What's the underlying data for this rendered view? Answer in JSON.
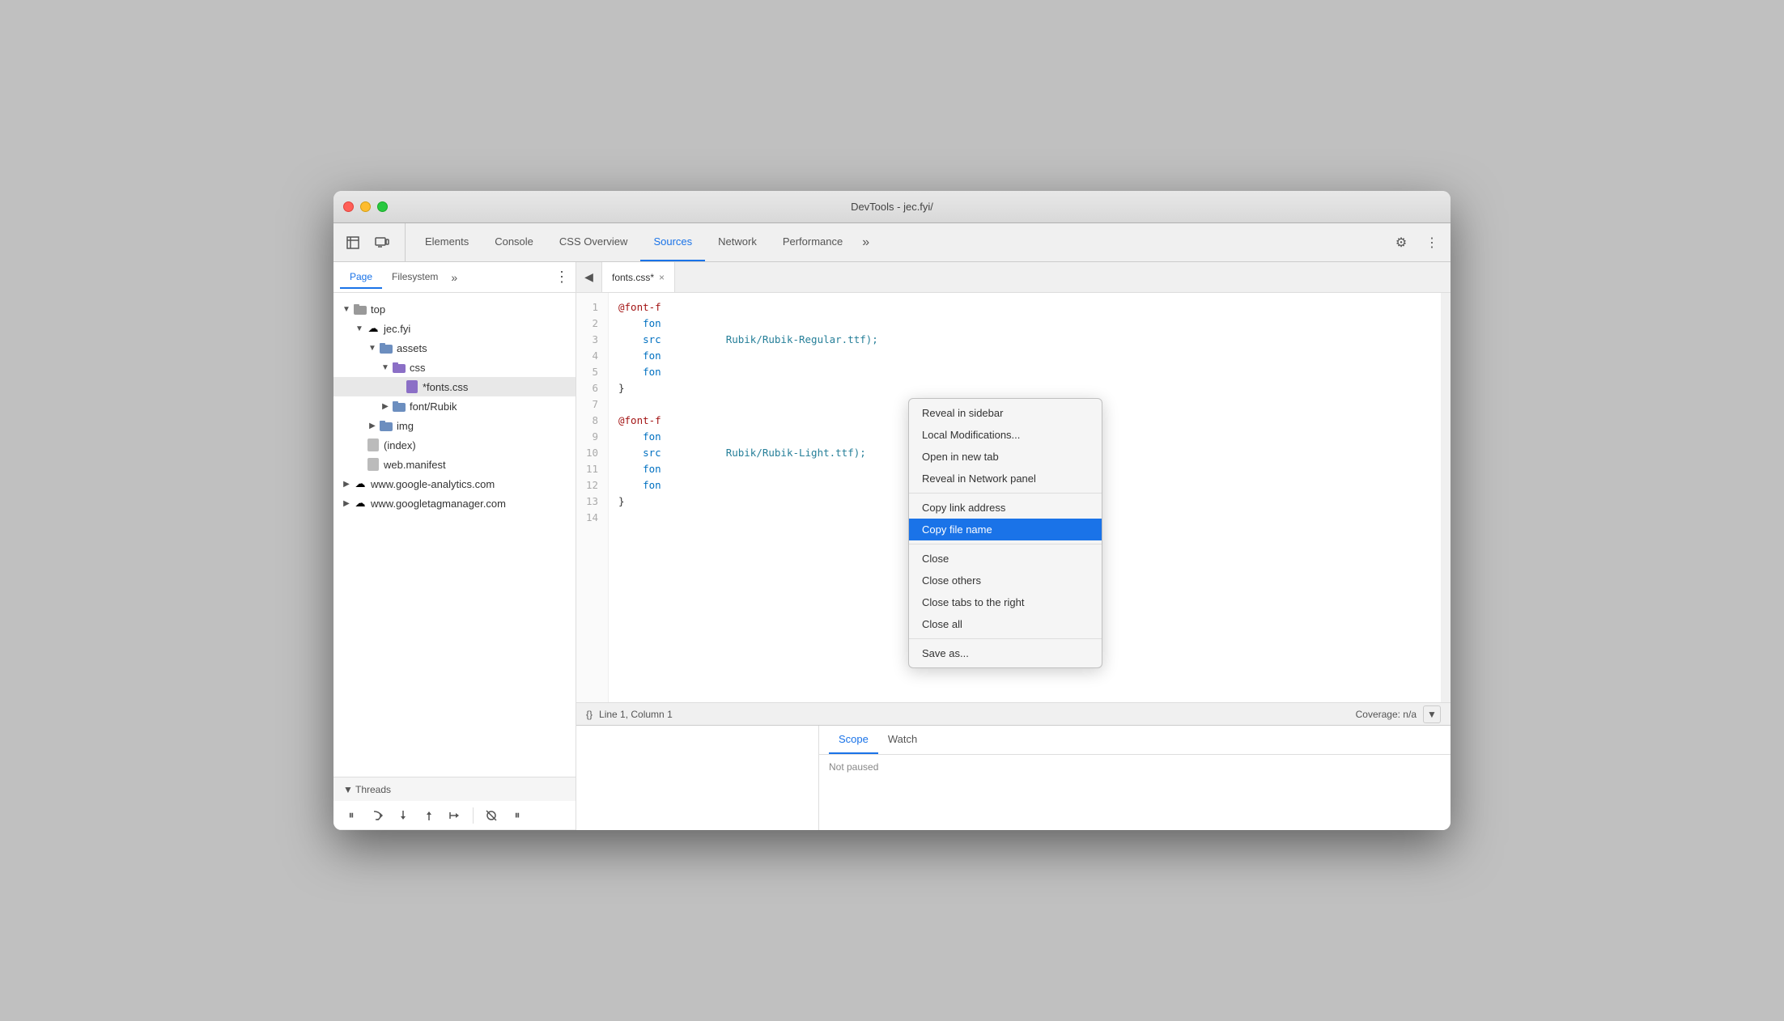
{
  "window": {
    "title": "DevTools - jec.fyi/"
  },
  "tabbar": {
    "inspect_icon": "⬚",
    "device_icon": "▭",
    "tabs": [
      {
        "label": "Elements",
        "active": false
      },
      {
        "label": "Console",
        "active": false
      },
      {
        "label": "CSS Overview",
        "active": false
      },
      {
        "label": "Sources",
        "active": true
      },
      {
        "label": "Network",
        "active": false
      },
      {
        "label": "Performance",
        "active": false
      }
    ],
    "more_label": "»",
    "gear_icon": "⚙",
    "dots_icon": "⋮"
  },
  "sidebar": {
    "tabs": [
      {
        "label": "Page",
        "active": true
      },
      {
        "label": "Filesystem",
        "active": false
      }
    ],
    "more_label": "»",
    "options_icon": "⋮",
    "tree": [
      {
        "label": "top",
        "level": 1,
        "type": "folder-plain",
        "expanded": true,
        "toggle": "▼"
      },
      {
        "label": "jec.fyi",
        "level": 2,
        "type": "cloud",
        "expanded": true,
        "toggle": "▼"
      },
      {
        "label": "assets",
        "level": 3,
        "type": "folder",
        "expanded": true,
        "toggle": "▼"
      },
      {
        "label": "css",
        "level": 4,
        "type": "folder-purple",
        "expanded": true,
        "toggle": "▼"
      },
      {
        "label": "*fonts.css",
        "level": 5,
        "type": "file-css",
        "selected": true
      },
      {
        "label": "font/Rubik",
        "level": 4,
        "type": "folder",
        "expanded": false,
        "toggle": "▶"
      },
      {
        "label": "img",
        "level": 3,
        "type": "folder",
        "expanded": false,
        "toggle": "▶"
      },
      {
        "label": "(index)",
        "level": 2,
        "type": "file-gray"
      },
      {
        "label": "web.manifest",
        "level": 2,
        "type": "file-gray"
      },
      {
        "label": "www.google-analytics.com",
        "level": 1,
        "type": "cloud",
        "expanded": false,
        "toggle": "▶"
      },
      {
        "label": "www.googletagmanager.com",
        "level": 1,
        "type": "cloud",
        "expanded": false,
        "toggle": "▶"
      }
    ]
  },
  "file_tab": {
    "name": "fonts.css*",
    "close": "×"
  },
  "code": {
    "lines": [
      {
        "num": 1,
        "content": "@font-f",
        "class": "c-red"
      },
      {
        "num": 2,
        "content": "    fon",
        "class": "c-blue"
      },
      {
        "num": 3,
        "content": "    src",
        "class": "c-blue",
        "suffix": "Rubik/Rubik-Regular.ttf);",
        "suffix_class": "c-teal"
      },
      {
        "num": 4,
        "content": "    fon",
        "class": "c-blue"
      },
      {
        "num": 5,
        "content": "    fon",
        "class": "c-blue"
      },
      {
        "num": 6,
        "content": "}",
        "class": "c-dark"
      },
      {
        "num": 7,
        "content": "",
        "class": ""
      },
      {
        "num": 8,
        "content": "@font-f",
        "class": "c-red"
      },
      {
        "num": 9,
        "content": "    fon",
        "class": "c-blue"
      },
      {
        "num": 10,
        "content": "    src",
        "class": "c-blue",
        "suffix": "Rubik/Rubik-Light.ttf);",
        "suffix_class": "c-teal"
      },
      {
        "num": 11,
        "content": "    fon",
        "class": "c-blue"
      },
      {
        "num": 12,
        "content": "    fon",
        "class": "c-blue"
      },
      {
        "num": 13,
        "content": "}",
        "class": "c-dark"
      },
      {
        "num": 14,
        "content": "",
        "class": ""
      }
    ]
  },
  "status_bar": {
    "format_icon": "{}",
    "position": "Line 1, Column 1",
    "coverage": "Coverage: n/a"
  },
  "context_menu": {
    "items": [
      {
        "label": "Reveal in sidebar",
        "type": "item"
      },
      {
        "label": "Local Modifications...",
        "type": "item"
      },
      {
        "label": "Open in new tab",
        "type": "item"
      },
      {
        "label": "Reveal in Network panel",
        "type": "item"
      },
      {
        "label": "",
        "type": "separator"
      },
      {
        "label": "Copy link address",
        "type": "item"
      },
      {
        "label": "Copy file name",
        "type": "item",
        "highlighted": true
      },
      {
        "label": "",
        "type": "separator"
      },
      {
        "label": "Close",
        "type": "item"
      },
      {
        "label": "Close others",
        "type": "item"
      },
      {
        "label": "Close tabs to the right",
        "type": "item"
      },
      {
        "label": "Close all",
        "type": "item"
      },
      {
        "label": "",
        "type": "separator"
      },
      {
        "label": "Save as...",
        "type": "item"
      }
    ]
  },
  "bottom": {
    "toolbar": {
      "pause_icon": "⏸",
      "step_over_icon": "↩",
      "step_into_icon": "↓",
      "step_out_icon": "↑",
      "step_icon": "→→",
      "deactivate_icon": "⊘",
      "pause_exceptions_icon": "⏸"
    },
    "threads_label": "▼ Threads",
    "tabs": [
      {
        "label": "Scope",
        "active": true
      },
      {
        "label": "Watch",
        "active": false
      }
    ],
    "scope_content": "Not paused"
  }
}
